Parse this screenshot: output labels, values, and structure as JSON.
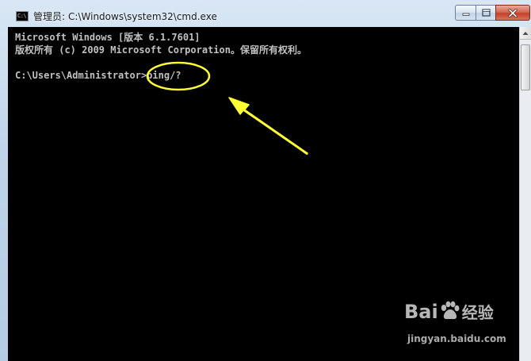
{
  "window": {
    "title_prefix": "管理员:",
    "title_path": "C:\\Windows\\system32\\cmd.exe",
    "icon_label": "C:\\"
  },
  "caption_buttons": {
    "minimize_icon": "minimize-icon",
    "maximize_icon": "maximize-icon",
    "close_icon": "close-icon"
  },
  "console": {
    "lines": [
      "Microsoft Windows [版本 6.1.7601]",
      "版权所有 (c) 2009 Microsoft Corporation。保留所有权利。",
      "C:\\Users\\Administrator>ping/?"
    ],
    "background": "#000000",
    "text_color": "#c0c0c0"
  },
  "annotation": {
    "color": "#ffff33",
    "shapes": [
      "ellipse-highlight",
      "arrow"
    ]
  },
  "watermark": {
    "logo_text": "Bai",
    "logo_suffix": "经验",
    "url": "jingyan.baidu.com"
  }
}
